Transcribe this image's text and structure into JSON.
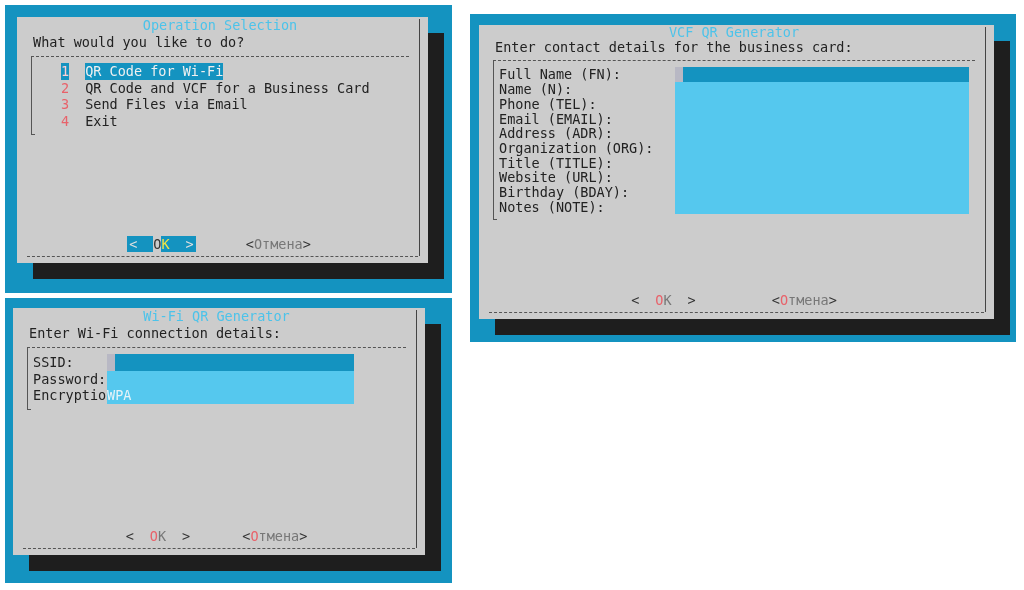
{
  "left": [
    {
      "kind": "menu",
      "title": "Operation Selection",
      "prompt": "What would you like to do?",
      "items": [
        {
          "tag": "1",
          "label": "QR Code for Wi-Fi",
          "selected": true
        },
        {
          "tag": "2",
          "label": "QR Code and VCF for a Business Card",
          "selected": false
        },
        {
          "tag": "3",
          "label": "Send Files via Email",
          "selected": false
        },
        {
          "tag": "4",
          "label": "Exit",
          "selected": false
        }
      ],
      "buttons": [
        {
          "left": "<",
          "label": "OK",
          "right": ">",
          "selected": true,
          "hotkey": false
        },
        {
          "left": "<",
          "label": "Отмена",
          "right": ">",
          "selected": false,
          "hotkey": false
        }
      ]
    },
    {
      "kind": "form",
      "title": "Wi-Fi QR Generator",
      "prompt": "Enter Wi-Fi connection details:",
      "fields": [
        {
          "label": "SSID:",
          "focused": true
        },
        {
          "label": "Password:",
          "focused": false
        },
        {
          "label": "Encryptio",
          "value": "WPA",
          "focused": false
        }
      ],
      "buttons": [
        {
          "left": "<",
          "label": "OK",
          "right": ">",
          "selected": false,
          "hotkey": true
        },
        {
          "left": "<",
          "label": "Отмена",
          "right": ">",
          "selected": false,
          "hotkey": true
        }
      ]
    }
  ],
  "right": [
    {
      "kind": "form",
      "title": "VCF QR Generator",
      "prompt": "Enter contact details for the business card:",
      "fields": [
        {
          "label": "Full Name (FN):",
          "focused": true
        },
        {
          "label": "Name (N):",
          "focused": false
        },
        {
          "label": "Phone (TEL):",
          "focused": false
        },
        {
          "label": "Email (EMAIL):",
          "focused": false
        },
        {
          "label": "Address (ADR):",
          "focused": false
        },
        {
          "label": "Organization (ORG):",
          "focused": false
        },
        {
          "label": "Title (TITLE):",
          "focused": false
        },
        {
          "label": "Website (URL):",
          "focused": false
        },
        {
          "label": "Birthday (BDAY):",
          "focused": false
        },
        {
          "label": "Notes (NOTE):",
          "focused": false
        }
      ],
      "buttons": [
        {
          "left": "<",
          "label": "OK",
          "right": ">",
          "selected": false,
          "hotkey": true
        },
        {
          "left": "<",
          "label": "Отмена",
          "right": ">",
          "selected": false,
          "hotkey": true
        }
      ]
    }
  ]
}
